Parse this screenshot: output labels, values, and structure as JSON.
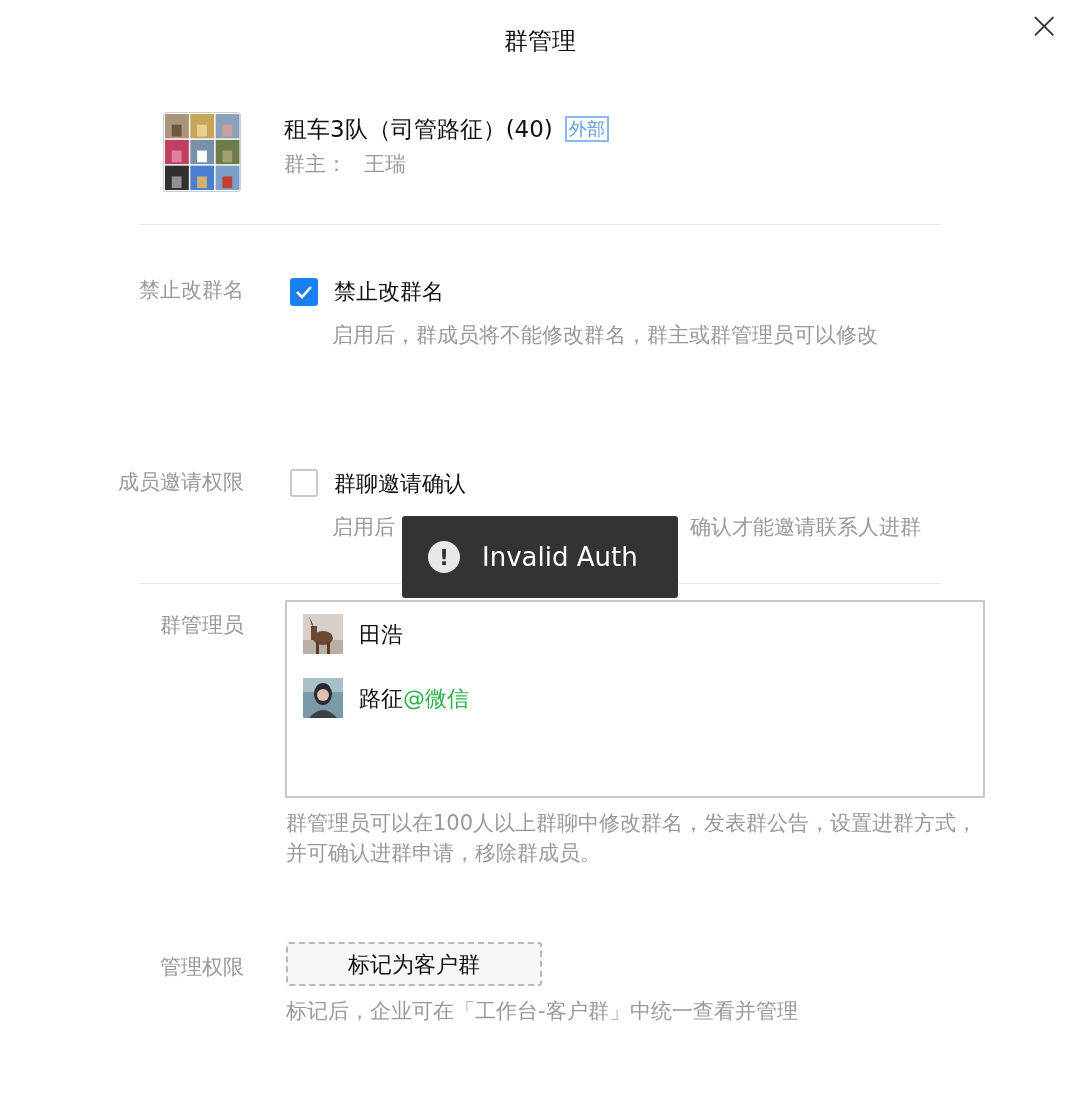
{
  "dialog": {
    "title": "群管理",
    "close": "×"
  },
  "group": {
    "name": "租车3队（司管路征）(40)",
    "badge": "外部",
    "owner_label": "群主：",
    "owner": "王瑞"
  },
  "settings": [
    {
      "label": "禁止改群名",
      "option": "禁止改群名",
      "checked": true,
      "hint": [
        "启用后，群成员将不能修改群名，群主或群管理员可以修改"
      ]
    },
    {
      "label": "成员邀请权限",
      "option": "群聊邀请确认",
      "checked": false,
      "hint": [
        "启用后",
        "确认才能邀请联系人进群"
      ]
    }
  ],
  "admins": {
    "label": "群管理员",
    "members": [
      {
        "name": "田浩"
      },
      {
        "name": "路征",
        "tag": "@微信"
      }
    ],
    "hint": "群管理员可以在100人以上群聊中修改群名，发表群公告，设置进群方式，并可确认进群申请，移除群成员。"
  },
  "manage": {
    "label": "管理权限",
    "button": "标记为客户群",
    "hint": "标记后，企业可在「工作台-客户群」中统一查看并管理"
  },
  "toast": {
    "icon": "!",
    "message": "Invalid Auth"
  }
}
